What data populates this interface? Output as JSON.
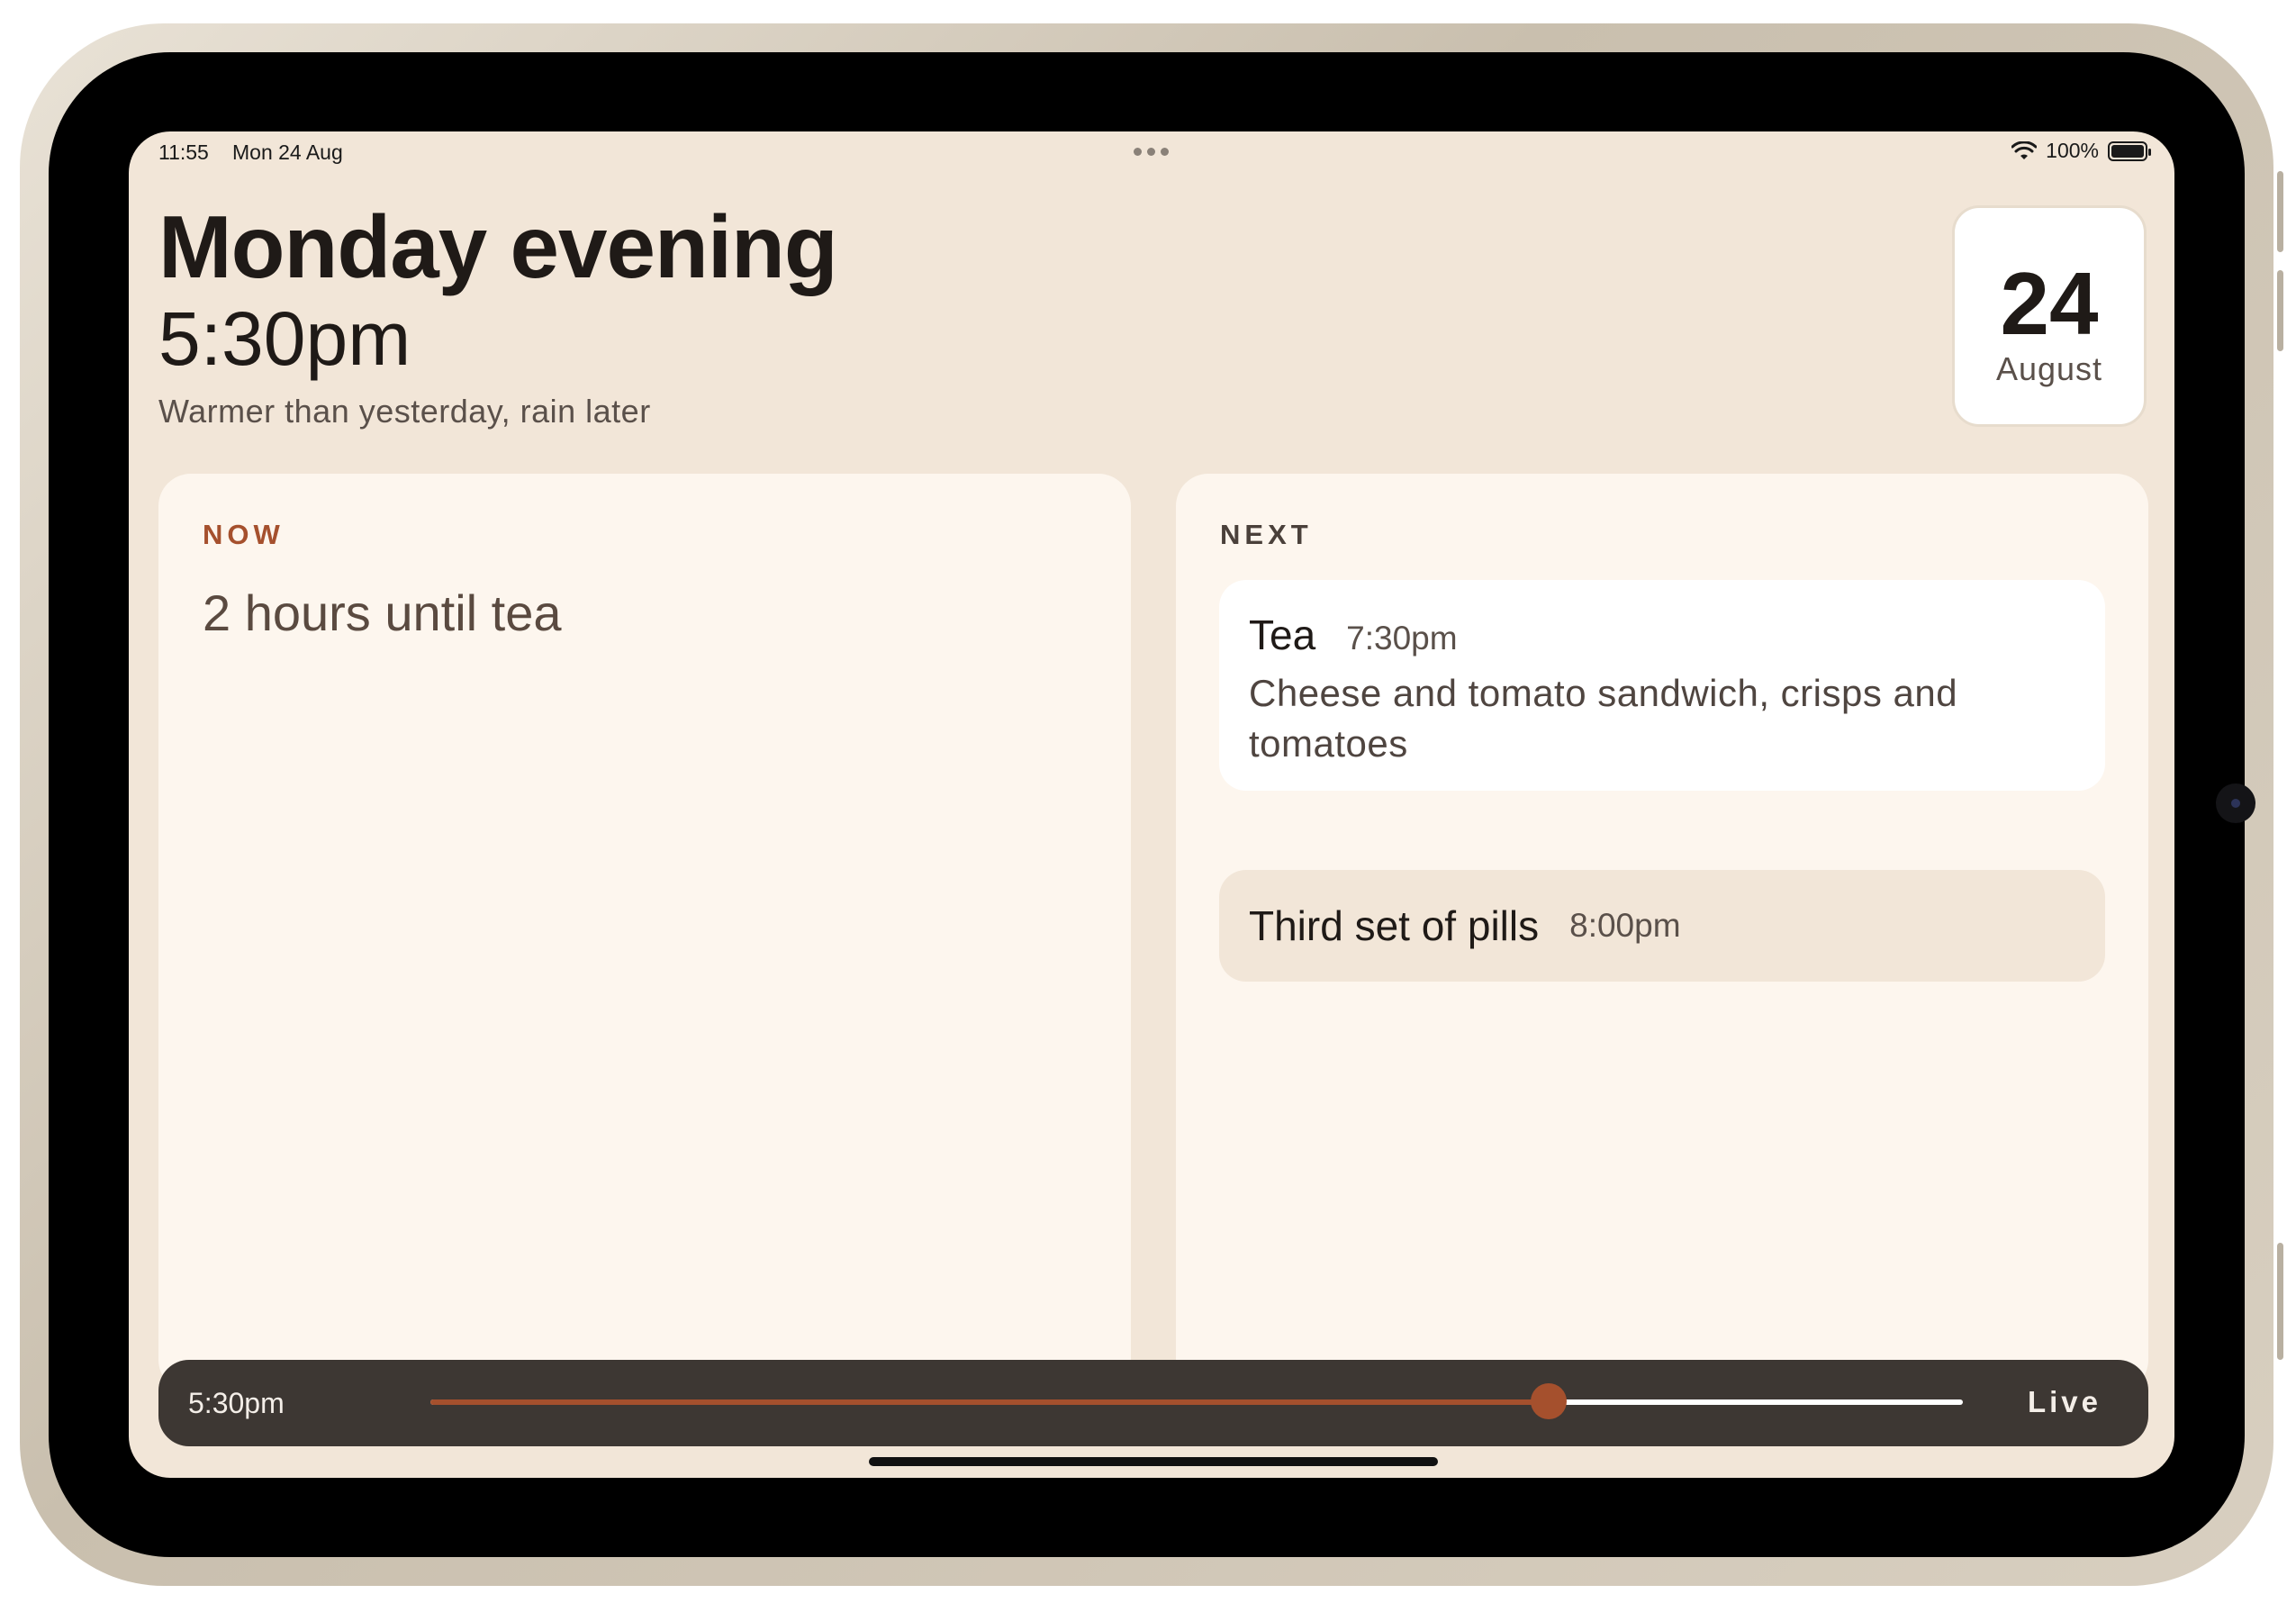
{
  "status_bar": {
    "time": "11:55",
    "date": "Mon 24 Aug",
    "battery": "100%",
    "battery_level": 1.0
  },
  "header": {
    "title": "Monday evening",
    "time": "5:30pm",
    "subtitle": "Warmer than yesterday, rain later",
    "date_card": {
      "day": "24",
      "month": "August"
    }
  },
  "now": {
    "label": "NOW",
    "text": "2 hours until tea"
  },
  "next": {
    "label": "NEXT",
    "events": [
      {
        "name": "Tea",
        "time": "7:30pm",
        "description": "Cheese and tomato sandwich, crisps and tomatoes"
      },
      {
        "name": "Third set of pills",
        "time": "8:00pm"
      }
    ]
  },
  "scrubber": {
    "time": "5:30pm",
    "live_label": "Live",
    "progress": 0.73
  },
  "colors": {
    "accent": "#a5502d",
    "background": "#f2e6d8",
    "panel": "#fdf6ee",
    "scrubber_bar": "#3d3733"
  }
}
